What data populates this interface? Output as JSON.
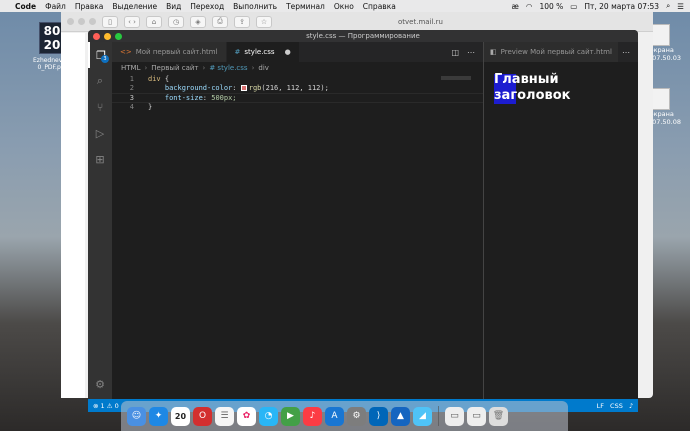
{
  "menubar": {
    "apple": "",
    "items": [
      "Code",
      "Файл",
      "Правка",
      "Выделение",
      "Вид",
      "Переход",
      "Выполнить",
      "Терминал",
      "Окно",
      "Справка"
    ],
    "status": {
      "input_lang": "æ",
      "battery": "100 %",
      "datetime": "Пт, 20 марта  07:53"
    }
  },
  "desktop": {
    "left_item": {
      "badge": "80 20",
      "label": "Ezhednevni...\n0_PDF.p..."
    },
    "right_items": [
      {
        "label": "экрана\n.07.50.03"
      },
      {
        "label": "экрана\n.07.50.08"
      }
    ]
  },
  "browser": {
    "url": "otvet.mail.ru"
  },
  "vscode": {
    "window_title": "style.css — Программирование",
    "tabs": [
      {
        "icon": "<>",
        "label": "Мой первый сайт.html",
        "active": false
      },
      {
        "icon": "#",
        "label": "style.css",
        "active": true,
        "dirty": "●"
      }
    ],
    "breadcrumbs": [
      "HTML",
      "Первый сайт",
      "# style.css",
      "div"
    ],
    "code_lines": [
      {
        "num": "1",
        "selector": "div",
        "rest": " {"
      },
      {
        "num": "2",
        "prop": "background-color",
        "fn": "rgb",
        "value": "(216, 112, 112);"
      },
      {
        "num": "3",
        "prop": "font-size",
        "value": "500px;"
      },
      {
        "num": "4",
        "text": "}"
      }
    ],
    "preview_tab": "Preview Мой первый сайт.html",
    "preview_heading_line1": "Главный",
    "preview_heading_line2": "заголовок",
    "activity_badge": "3",
    "status": {
      "left": "⊗ 1 ⚠ 0",
      "right": [
        "LF",
        "CSS"
      ]
    }
  },
  "dock": {
    "calendar_day": "20"
  },
  "colors": {
    "swatch": "#d87070",
    "statusbar": "#007acc"
  }
}
